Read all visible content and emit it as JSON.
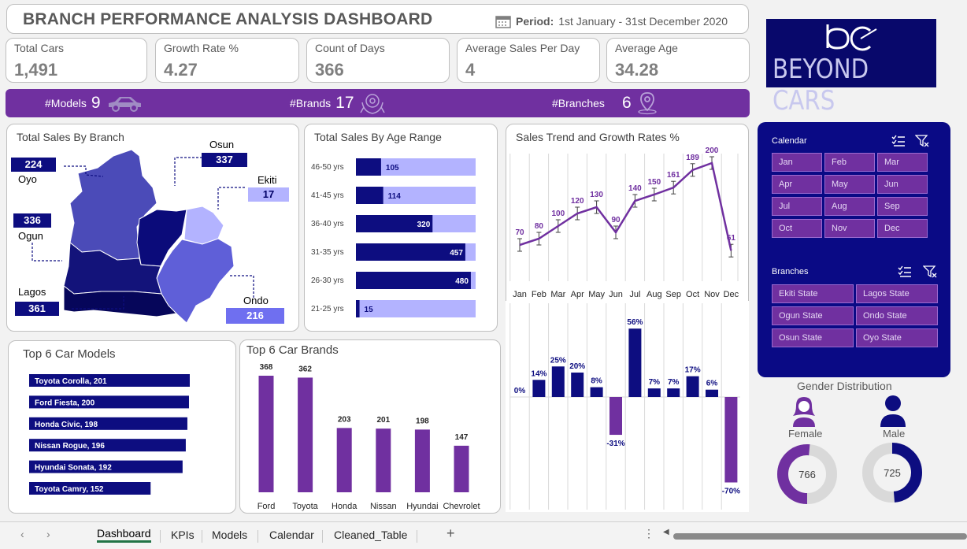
{
  "title": "BRANCH PERFORMANCE ANALYSIS DASHBOARD",
  "period": {
    "label": "Period:",
    "value": "1st January - 31st December 2020"
  },
  "kpis": [
    {
      "label": "Total Cars",
      "value": "1,491"
    },
    {
      "label": "Growth Rate %",
      "value": "4.27"
    },
    {
      "label": "Count of Days",
      "value": "366"
    },
    {
      "label": "Average Sales Per Day",
      "value": "4"
    },
    {
      "label": "Average Age",
      "value": "34.28"
    }
  ],
  "stats": {
    "models": {
      "label": "#Models",
      "value": "9"
    },
    "brands": {
      "label": "#Brands",
      "value": "17"
    },
    "branches": {
      "label": "#Branches",
      "value": "6"
    }
  },
  "logo": {
    "text": "BEYOND CARS"
  },
  "colors": {
    "navy": "#0d0d80",
    "purple": "#7030a0",
    "light": "#b3b3ff",
    "mid": "#6f6ff0"
  },
  "branch_map": {
    "title": "Total Sales By Branch",
    "branches": [
      {
        "name": "Oyo",
        "value": "224"
      },
      {
        "name": "Osun",
        "value": "337"
      },
      {
        "name": "Ekiti",
        "value": "17"
      },
      {
        "name": "Ogun",
        "value": "336"
      },
      {
        "name": "Lagos",
        "value": "361"
      },
      {
        "name": "Ondo",
        "value": "216"
      }
    ]
  },
  "chart_data": [
    {
      "type": "bar",
      "title": "Total Sales By Age Range",
      "categories": [
        "46-50 yrs",
        "41-45 yrs",
        "36-40 yrs",
        "31-35 yrs",
        "26-30 yrs",
        "21-25 yrs"
      ],
      "values": [
        105,
        114,
        320,
        457,
        480,
        15
      ],
      "xlim": [
        0,
        500
      ],
      "orientation": "horizontal"
    },
    {
      "type": "line",
      "title": "Sales Trend and Growth Rates %",
      "categories": [
        "Jan",
        "Feb",
        "Mar",
        "Apr",
        "May",
        "Jun",
        "Jul",
        "Aug",
        "Sep",
        "Oct",
        "Nov",
        "Dec"
      ],
      "values": [
        70,
        80,
        100,
        120,
        130,
        90,
        140,
        150,
        161,
        189,
        200,
        61
      ]
    },
    {
      "type": "bar",
      "title": "",
      "categories": [
        "Jan",
        "Feb",
        "Mar",
        "Apr",
        "May",
        "Jun",
        "Jul",
        "Aug",
        "Sep",
        "Oct",
        "Nov",
        "Dec"
      ],
      "values": [
        0,
        14,
        25,
        20,
        8,
        -31,
        56,
        7,
        7,
        17,
        6,
        -70
      ],
      "labels": [
        "0%",
        "14%",
        "25%",
        "20%",
        "8%",
        "-31%",
        "56%",
        "7%",
        "7%",
        "17%",
        "6%",
        "-70%"
      ]
    },
    {
      "type": "bar",
      "title": "Top 6 Car Models",
      "orientation": "horizontal",
      "categories": [
        "Toyota Corolla",
        "Ford Fiesta",
        "Honda Civic",
        "Nissan Rogue",
        "Hyundai Sonata",
        "Toyota Camry"
      ],
      "values": [
        201,
        200,
        198,
        196,
        192,
        152
      ],
      "labels": [
        "Toyota Corolla, 201",
        "Ford Fiesta, 200",
        "Honda Civic, 198",
        "Nissan Rogue, 196",
        "Hyundai Sonata, 192",
        "Toyota Camry, 152"
      ]
    },
    {
      "type": "bar",
      "title": "Top 6 Car Brands",
      "categories": [
        "Ford",
        "Toyota",
        "Honda",
        "Nissan",
        "Hyundai",
        "Chevrolet"
      ],
      "values": [
        368,
        362,
        203,
        201,
        198,
        147
      ]
    },
    {
      "type": "pie",
      "title": "Gender Distribution",
      "categories": [
        "Female",
        "Male"
      ],
      "values": [
        766,
        725
      ],
      "total": 1491
    }
  ],
  "slicer": {
    "calendar_title": "Calendar",
    "months": [
      "Jan",
      "Feb",
      "Mar",
      "Apr",
      "May",
      "Jun",
      "Jul",
      "Aug",
      "Sep",
      "Oct",
      "Nov",
      "Dec"
    ],
    "branches_title": "Branches",
    "branches": [
      "Ekiti State",
      "Lagos State",
      "Ogun State",
      "Ondo State",
      "Osun State",
      "Oyo State"
    ]
  },
  "tabs": [
    "Dashboard",
    "KPIs",
    "Models",
    "Calendar",
    "Cleaned_Table"
  ]
}
